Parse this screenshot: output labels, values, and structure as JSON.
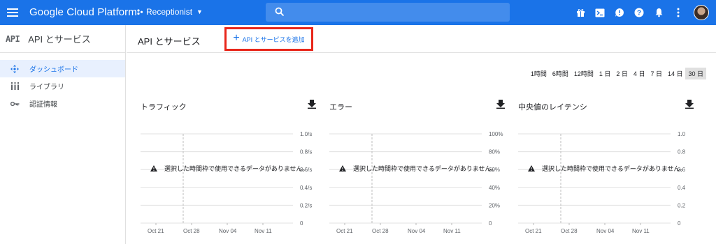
{
  "header": {
    "brand": "Google Cloud Platform",
    "project": "Receptionist",
    "search_placeholder": "",
    "accent": "#1a73e8"
  },
  "sidebar": {
    "badge": "API",
    "title": "API とサービス",
    "items": [
      {
        "label": "ダッシュボード",
        "icon": "dashboard-icon",
        "active": true
      },
      {
        "label": "ライブラリ",
        "icon": "library-icon",
        "active": false
      },
      {
        "label": "認証情報",
        "icon": "key-icon",
        "active": false
      }
    ]
  },
  "main": {
    "title": "API とサービス",
    "add_button": "API とサービスを追加",
    "time_ranges": [
      "1時間",
      "6時間",
      "12時間",
      "1 日",
      "2 日",
      "4 日",
      "7 日",
      "14 日",
      "30 日"
    ],
    "selected_range": "30 日",
    "no_data_message": "選択した時間枠で使用できるデータがありません。"
  },
  "chart_data": [
    {
      "type": "line",
      "title": "トラフィック",
      "x_ticks": [
        "Oct 21",
        "Oct 28",
        "Nov 04",
        "Nov 11"
      ],
      "y_ticks": [
        "1.0/s",
        "0.8/s",
        "0.6/s",
        "0.4/s",
        "0.2/s",
        "0"
      ],
      "series": [],
      "grid": true
    },
    {
      "type": "line",
      "title": "エラー",
      "x_ticks": [
        "Oct 21",
        "Oct 28",
        "Nov 04",
        "Nov 11"
      ],
      "y_ticks": [
        "100%",
        "80%",
        "60%",
        "40%",
        "20%",
        "0"
      ],
      "series": [],
      "grid": true
    },
    {
      "type": "line",
      "title": "中央値のレイテンシ",
      "x_ticks": [
        "Oct 21",
        "Oct 28",
        "Nov 04",
        "Nov 11"
      ],
      "y_ticks": [
        "1.0",
        "0.8",
        "0.6",
        "0.4",
        "0.2",
        "0"
      ],
      "series": [],
      "grid": true
    }
  ]
}
